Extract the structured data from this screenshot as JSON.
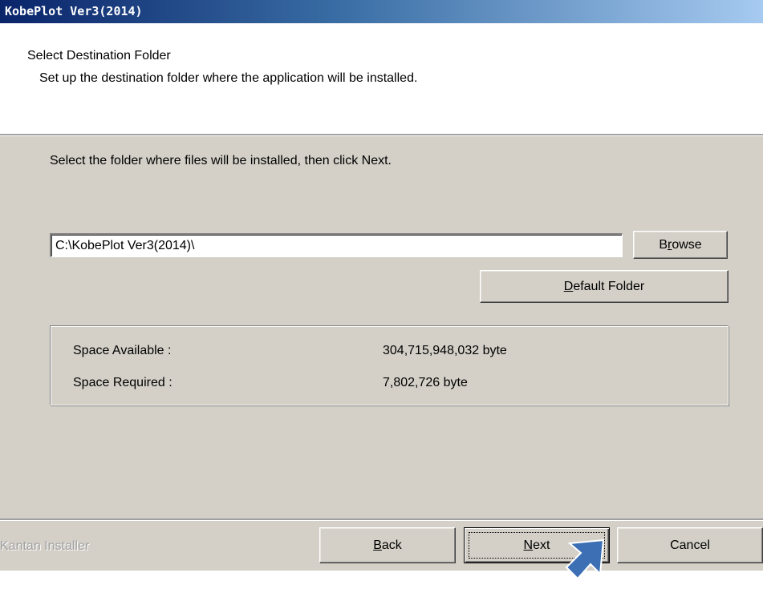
{
  "window": {
    "title": "KobePlot Ver3(2014)"
  },
  "header": {
    "title": "Select Destination Folder",
    "subtitle": "Set up the destination folder where the application will be installed."
  },
  "body": {
    "instruction": "Select the folder where files will be installed, then click Next.",
    "path_value": "C:\\KobePlot Ver3(2014)\\",
    "browse": {
      "pre": "B",
      "key": "r",
      "post": "owse"
    },
    "default_folder": {
      "pre": "",
      "key": "D",
      "post": "efault Folder"
    },
    "space": {
      "available_label": "Space Available :",
      "available_value": "304,715,948,032 byte",
      "required_label": "Space Required :",
      "required_value": "7,802,726 byte"
    }
  },
  "footer": {
    "brand": "Kantan Installer",
    "back": {
      "pre": "",
      "key": "B",
      "post": "ack"
    },
    "next": {
      "pre": "",
      "key": "N",
      "post": "ext"
    },
    "cancel": "Cancel"
  },
  "colors": {
    "dialog_bg": "#d4d0c8",
    "titlebar_start": "#0a246a",
    "titlebar_end": "#a6caf0",
    "pointer_arrow": "#3c6fb4"
  },
  "icons": {
    "pointer": "arrow-pointer-icon"
  }
}
